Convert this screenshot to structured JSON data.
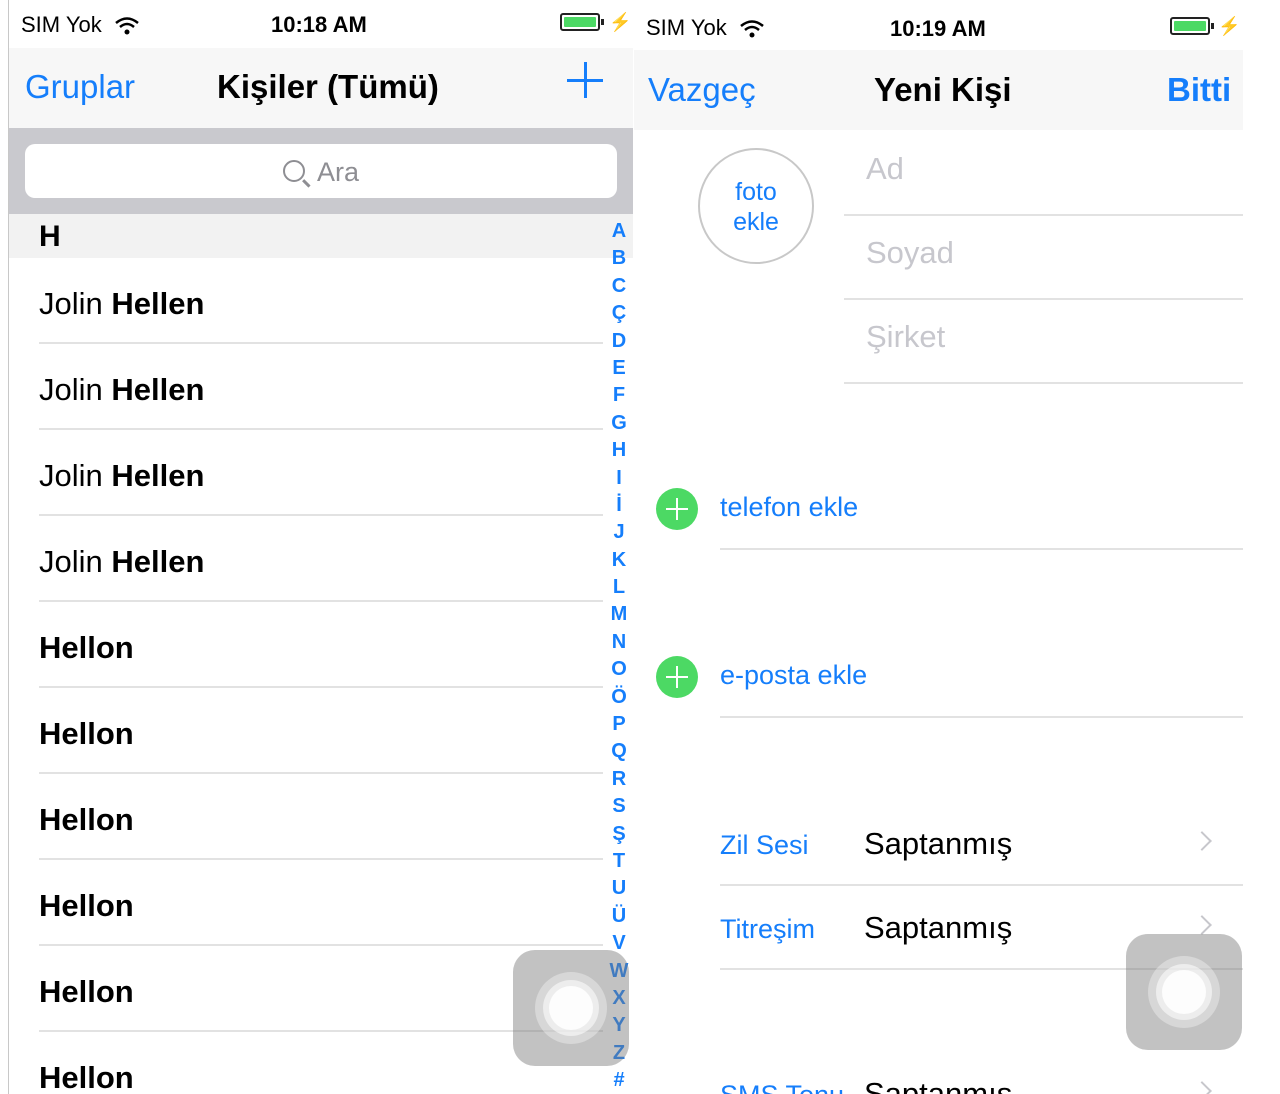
{
  "left_screen": {
    "status": {
      "carrier": "SIM Yok",
      "time": "10:18 AM",
      "bolt": "⚡"
    },
    "nav": {
      "left": "Gruplar",
      "title": "Kişiler (Tümü)",
      "right_icon": "plus-icon"
    },
    "search": {
      "placeholder": "Ara"
    },
    "section": "H",
    "contacts": [
      {
        "first": "Jolin",
        "last": "Hellen"
      },
      {
        "first": "Jolin",
        "last": "Hellen"
      },
      {
        "first": "Jolin",
        "last": "Hellen"
      },
      {
        "first": "Jolin",
        "last": "Hellen"
      },
      {
        "first": "",
        "last": "Hellon"
      },
      {
        "first": "",
        "last": "Hellon"
      },
      {
        "first": "",
        "last": "Hellon"
      },
      {
        "first": "",
        "last": "Hellon"
      },
      {
        "first": "",
        "last": "Hellon"
      },
      {
        "first": "",
        "last": "Hellon"
      }
    ],
    "index": [
      "A",
      "B",
      "C",
      "Ç",
      "D",
      "E",
      "F",
      "G",
      "H",
      "I",
      "İ",
      "J",
      "K",
      "L",
      "M",
      "N",
      "O",
      "Ö",
      "P",
      "Q",
      "R",
      "S",
      "Ş",
      "T",
      "U",
      "Ü",
      "V",
      "W",
      "X",
      "Y",
      "Z",
      "#"
    ]
  },
  "right_screen": {
    "status": {
      "carrier": "SIM Yok",
      "time": "10:19 AM",
      "bolt": "⚡"
    },
    "nav": {
      "left": "Vazgeç",
      "title": "Yeni Kişi",
      "right": "Bitti"
    },
    "photo": {
      "line1": "foto",
      "line2": "ekle"
    },
    "fields": {
      "first_name": "Ad",
      "last_name": "Soyad",
      "company": "Şirket"
    },
    "add_phone": "telefon ekle",
    "add_email": "e-posta ekle",
    "settings": [
      {
        "label": "Zil Sesi",
        "value": "Saptanmış"
      },
      {
        "label": "Titreşim",
        "value": "Saptanmış"
      },
      {
        "label": "SMS Tonu",
        "value": "Saptanmış"
      }
    ]
  },
  "colors": {
    "accent": "#157efb",
    "add_green": "#4cd964",
    "battery": "#4cd964"
  }
}
